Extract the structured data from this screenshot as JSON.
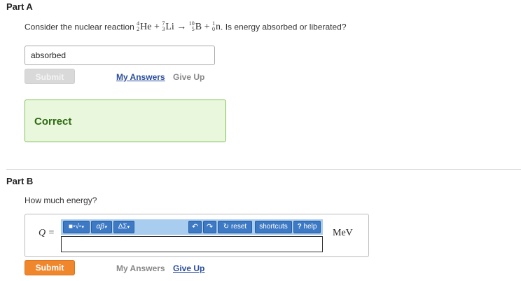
{
  "part_a": {
    "title": "Part A",
    "question_prefix": "Consider the nuclear reaction",
    "reaction": {
      "r1": {
        "mass": "4",
        "atomic": "2",
        "symbol": "He"
      },
      "plus1": "+",
      "r2": {
        "mass": "7",
        "atomic": "3",
        "symbol": "Li"
      },
      "arrow": "→",
      "p1": {
        "mass": "10",
        "atomic": "5",
        "symbol": "B"
      },
      "plus2": "+",
      "p2": {
        "mass": "1",
        "atomic": "0",
        "symbol": "n"
      }
    },
    "question_suffix": ". Is energy absorbed or liberated?",
    "answer_value": "absorbed",
    "submit_label": "Submit",
    "my_answers_label": "My Answers",
    "give_up_label": "Give Up",
    "feedback": "Correct"
  },
  "part_b": {
    "title": "Part B",
    "question": "How much energy?",
    "variable_label": "Q =",
    "toolbar": {
      "templates_label": "■▫√▫",
      "greek_label": "αβ",
      "symbols_label": "ΔΣ",
      "undo_icon": "undo-icon",
      "redo_icon": "redo-icon",
      "reset_label": "reset",
      "shortcuts_label": "shortcuts",
      "help_label": "help",
      "help_icon": "?"
    },
    "answer_value": "",
    "unit": "MeV",
    "submit_label": "Submit",
    "my_answers_label": "My Answers",
    "give_up_label": "Give Up"
  },
  "colors": {
    "submit_active": "#f0872d",
    "correct_bg": "#e9f7dc",
    "correct_border": "#7fc257",
    "toolbar_bg": "#a8cdef",
    "toolbar_button": "#3d79c4",
    "link_blue": "#2a4d9b"
  }
}
